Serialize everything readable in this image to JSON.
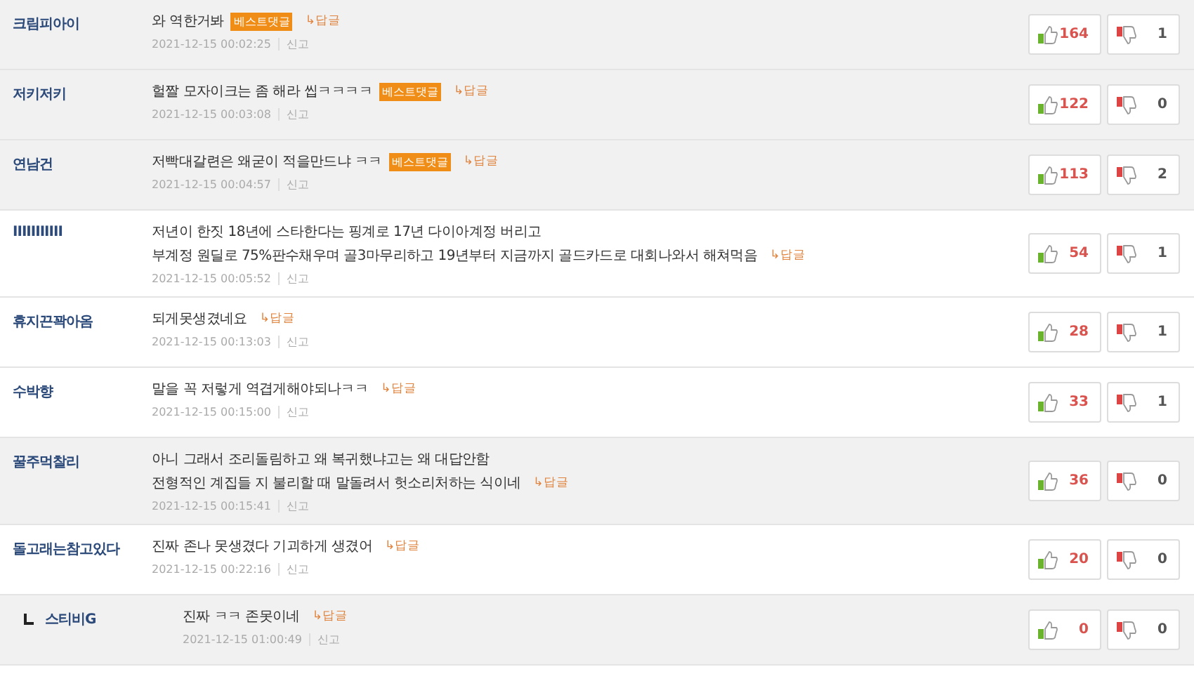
{
  "comments": [
    {
      "author": "크림피아이",
      "lines": [
        "와 역한거봐"
      ],
      "best_label": "베스트댓글",
      "reply": "↳답글",
      "time": "2021-12-15 00:02:25",
      "report": "신고",
      "likes": "164",
      "dislikes": "1",
      "shaded": true
    },
    {
      "author": "저키저키",
      "lines": [
        "헐짤 모자이크는 좀 해라 씹ㅋㅋㅋㅋ"
      ],
      "best_label": "베스트댓글",
      "reply": "↳답글",
      "time": "2021-12-15 00:03:08",
      "report": "신고",
      "likes": "122",
      "dislikes": "0",
      "shaded": true
    },
    {
      "author": "연남건",
      "lines": [
        "저빡대갈련은 왜굳이 적을만드냐 ㅋㅋ"
      ],
      "best_label": "베스트댓글",
      "reply": "↳답글",
      "time": "2021-12-15 00:04:57",
      "report": "신고",
      "likes": "113",
      "dislikes": "2",
      "shaded": true
    },
    {
      "author": "IIIIIIIIIII",
      "lines": [
        "저년이 한짓 18년에 스타한다는 핑계로 17년 다이아계정 버리고",
        "부계정 원딜로 75%판수채우며 골3마무리하고 19년부터 지금까지 골드카드로 대회나와서 해쳐먹음"
      ],
      "reply": "↳답글",
      "time": "2021-12-15 00:05:52",
      "report": "신고",
      "likes": "54",
      "dislikes": "1",
      "shaded": false
    },
    {
      "author": "휴지끈꽉아옴",
      "lines": [
        "되게못생겼네요"
      ],
      "reply": "↳답글",
      "time": "2021-12-15 00:13:03",
      "report": "신고",
      "likes": "28",
      "dislikes": "1",
      "shaded": false
    },
    {
      "author": "수박향",
      "lines": [
        "말을 꼭 저렇게 역겹게해야되나ㅋㅋ"
      ],
      "reply": "↳답글",
      "time": "2021-12-15 00:15:00",
      "report": "신고",
      "likes": "33",
      "dislikes": "1",
      "shaded": false
    },
    {
      "author": "꿀주먹찰리",
      "lines": [
        "아니 그래서 조리돌림하고 왜 복귀했냐고는 왜 대답안함",
        "전형적인 계집들 지 불리할 때 말돌려서 헛소리처하는 식이네"
      ],
      "reply": "↳답글",
      "time": "2021-12-15 00:15:41",
      "report": "신고",
      "likes": "36",
      "dislikes": "0",
      "shaded": true
    },
    {
      "author": "돌고래는참고있다",
      "lines": [
        "진짜 존나 못생겼다 기괴하게 생겼어"
      ],
      "reply": "↳답글",
      "time": "2021-12-15 00:22:16",
      "report": "신고",
      "likes": "20",
      "dislikes": "0",
      "shaded": false,
      "children": [
        {
          "author": "스티비G",
          "lines": [
            "진짜 ㅋㅋ 존못이네"
          ],
          "reply": "↳답글",
          "time": "2021-12-15 01:00:49",
          "report": "신고",
          "likes": "0",
          "dislikes": "0",
          "shaded": true
        }
      ]
    }
  ]
}
